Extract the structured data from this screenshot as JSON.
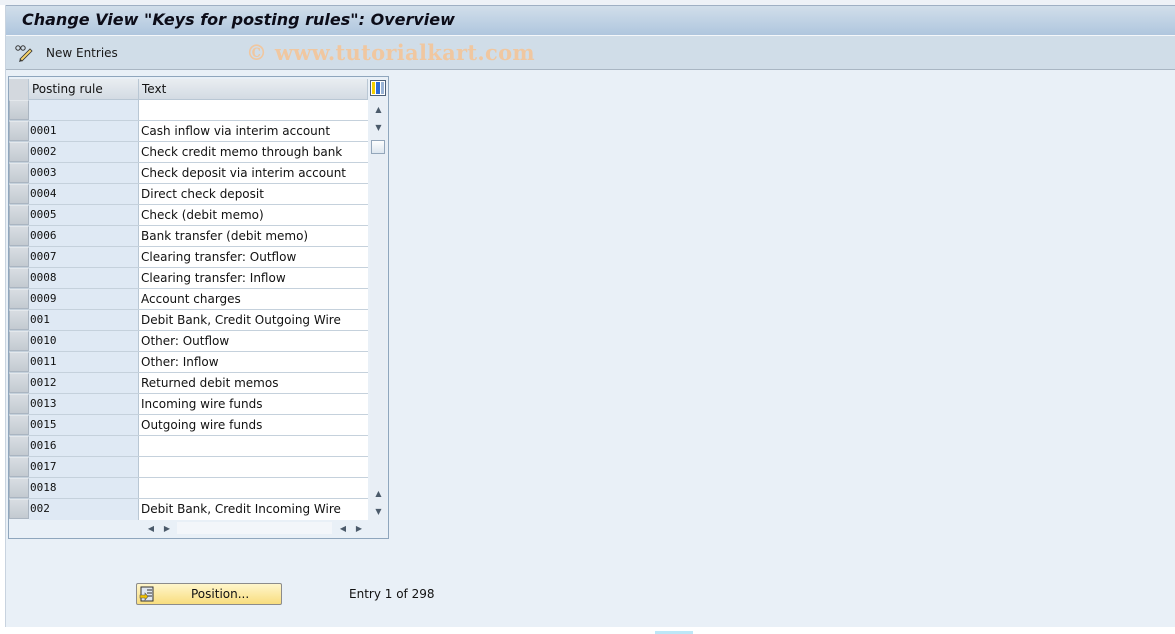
{
  "window": {
    "title": "Change View \"Keys for posting rules\": Overview",
    "watermark": "© www.tutorialkart.com"
  },
  "toolbar": {
    "new_entries": {
      "label": "New Entries",
      "icon": "pencil-glasses-icon"
    }
  },
  "table": {
    "columns": [
      "Posting rule",
      "Text"
    ],
    "column_config_icon": "column-config-icon",
    "rows": [
      {
        "key": "",
        "text": ""
      },
      {
        "key": "0001",
        "text": "Cash inflow via interim account"
      },
      {
        "key": "0002",
        "text": "Check credit memo through bank"
      },
      {
        "key": "0003",
        "text": "Check deposit via interim account"
      },
      {
        "key": "0004",
        "text": "Direct check deposit"
      },
      {
        "key": "0005",
        "text": "Check (debit memo)"
      },
      {
        "key": "0006",
        "text": "Bank transfer (debit memo)"
      },
      {
        "key": "0007",
        "text": "Clearing transfer: Outflow"
      },
      {
        "key": "0008",
        "text": "Clearing transfer: Inflow"
      },
      {
        "key": "0009",
        "text": "Account charges"
      },
      {
        "key": "001",
        "text": "Debit Bank, Credit Outgoing Wire"
      },
      {
        "key": "0010",
        "text": "Other: Outflow"
      },
      {
        "key": "0011",
        "text": "Other: Inflow"
      },
      {
        "key": "0012",
        "text": "Returned debit memos"
      },
      {
        "key": "0013",
        "text": "Incoming wire funds"
      },
      {
        "key": "0015",
        "text": "Outgoing wire funds"
      },
      {
        "key": "0016",
        "text": ""
      },
      {
        "key": "0017",
        "text": ""
      },
      {
        "key": "0018",
        "text": ""
      },
      {
        "key": "002",
        "text": "Debit Bank, Credit Incoming Wire"
      }
    ]
  },
  "footer": {
    "position_button": "Position...",
    "entry_text": "Entry 1 of 298"
  },
  "colors": {
    "button_yellow": "#f8dd7e",
    "key_column_bg": "#dfe9f4",
    "titlebar": "#afc6de",
    "watermark": "#f0c7a0"
  }
}
